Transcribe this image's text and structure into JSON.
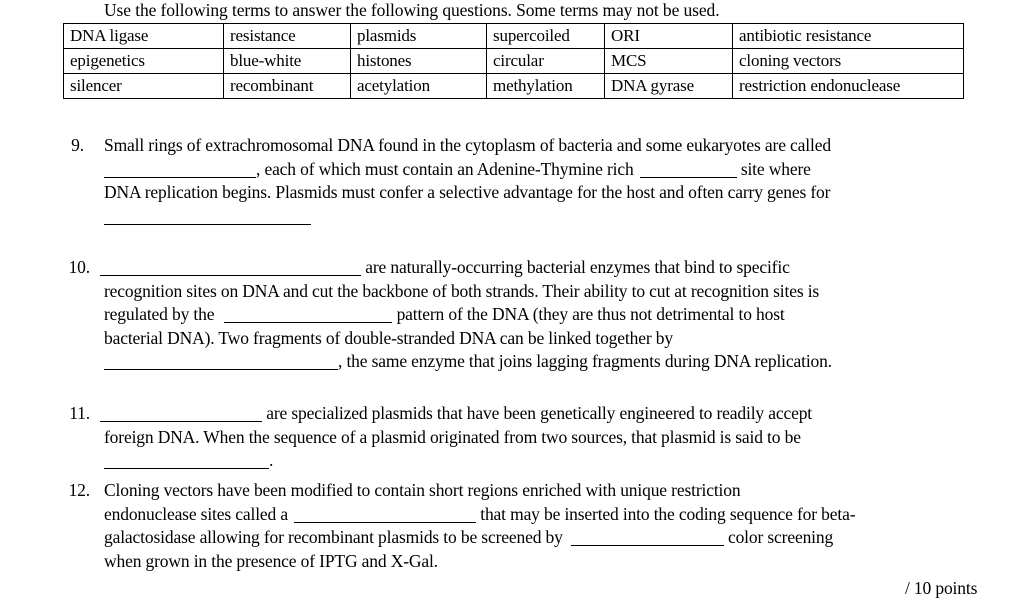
{
  "document": {
    "intro": "Use the following terms to answer the following questions.  Some terms may not be used.",
    "points_footer": "/ 10 points"
  },
  "word_bank": {
    "rows": [
      [
        "DNA ligase",
        "resistance",
        "plasmids",
        "supercoiled",
        "ORI",
        "antibiotic resistance"
      ],
      [
        "epigenetics",
        "blue-white",
        "histones",
        "circular",
        "MCS",
        "cloning vectors"
      ],
      [
        "silencer",
        "recombinant",
        "acetylation",
        "methylation",
        "DNA gyrase",
        "restriction endonuclease"
      ]
    ]
  },
  "questions": [
    {
      "number": "9.",
      "lines": [
        "Small rings of extrachromosomal DNA found in the cytoplasm of bacteria and some eukaryotes are called",
        ", each of which must contain an Adenine-Thymine rich",
        "site where",
        "DNA replication begins. Plasmids must confer a selective advantage for the host and often carry genes for"
      ],
      "full_text": "Small rings of extrachromosomal DNA found in the cytoplasm of bacteria and some eukaryotes are called ________________, each of which must contain an Adenine-Thymine rich _____________ site where DNA replication begins. Plasmids must confer a selective advantage for the host and often carry genes for _________________"
    },
    {
      "number": "10.",
      "lines": [
        "are naturally-occurring bacterial enzymes that bind to specific",
        "recognition sites on DNA and cut the backbone of both strands. Their ability to cut at recognition sites is",
        "regulated by the",
        "pattern of the DNA (they are thus not detrimental to host",
        "bacterial DNA). Two fragments of double-stranded DNA can be linked together by",
        ", the same enzyme that joins lagging fragments during DNA replication."
      ],
      "full_text": "______________________________ are naturally-occurring bacterial enzymes that bind to specific recognition sites on DNA and cut the backbone of both strands. Their ability to cut at recognition sites is regulated by the ____________________ pattern of the DNA (they are thus not detrimental to host bacterial DNA). Two fragments of double-stranded DNA can be linked together by ________________________, the same enzyme that joins lagging fragments during DNA replication."
    },
    {
      "number": "11.",
      "lines": [
        "are specialized plasmids that have been genetically engineered to readily accept",
        "foreign DNA. When the sequence of a plasmid originated from two sources, that plasmid is said to be",
        "."
      ],
      "full_text": "____________________ are specialized plasmids that have been genetically engineered to readily accept foreign DNA. When the sequence of a plasmid originated from two sources, that plasmid is said to be __________________."
    },
    {
      "number": "12.",
      "lines": [
        "Cloning vectors have been modified to contain short regions enriched with unique restriction",
        "endonuclease sites called a",
        "that may be inserted into the coding sequence for beta-",
        "galactosidase allowing for recombinant plasmids to be screened by",
        "color screening",
        "when grown in the presence of IPTG and X-Gal."
      ],
      "full_text": "Cloning vectors have been modified to contain short regions enriched with unique restriction endonuclease sites called a ___________________ that may be inserted into the coding sequence for beta-galactosidase allowing for recombinant plasmids to be screened by __________________ color screening when grown in the presence of IPTG and X-Gal."
    }
  ]
}
